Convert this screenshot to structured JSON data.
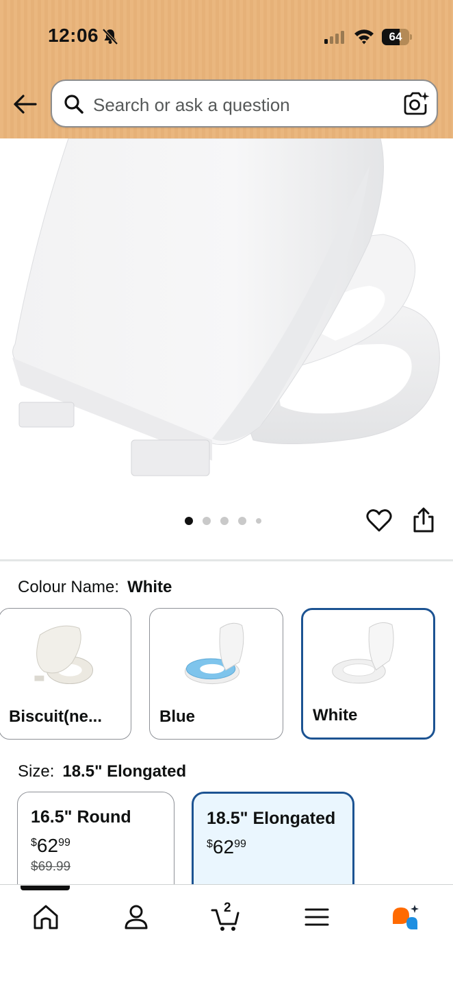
{
  "status_bar": {
    "time": "12:06",
    "battery": "64",
    "battery_level": 0.64
  },
  "search": {
    "placeholder": "Search or ask a question"
  },
  "gallery": {
    "image_count": 5,
    "active_index": 0
  },
  "colour": {
    "label": "Colour Name:",
    "selected": "White",
    "options": [
      {
        "label": "Biscuit(ne...",
        "seat_color": "#f1efe9",
        "ring_color": "#ece9e1"
      },
      {
        "label": "Blue",
        "seat_color": "#f4f4f4",
        "ring_color": "#7ec4ec"
      },
      {
        "label": "White",
        "seat_color": "#f6f6f6",
        "ring_color": "#f0f0f0"
      }
    ]
  },
  "size": {
    "label": "Size:",
    "selected": "18.5\" Elongated",
    "options": [
      {
        "name": "16.5\" Round",
        "currency": "$",
        "price_whole": "62",
        "price_fraction": "99",
        "list_price": "$69.99"
      },
      {
        "name": "18.5\" Elongated",
        "currency": "$",
        "price_whole": "62",
        "price_fraction": "99"
      }
    ]
  },
  "nav": {
    "cart_count": "2",
    "items": [
      "home-icon",
      "account-icon",
      "cart-icon",
      "menu-icon",
      "rufus-icon"
    ]
  },
  "colors": {
    "header": "#eab77f",
    "selected_border": "#1c5392",
    "selected_bg": "#eaf6fe",
    "rufus_orange": "#ff6a00",
    "rufus_blue": "#1e8fe1"
  }
}
